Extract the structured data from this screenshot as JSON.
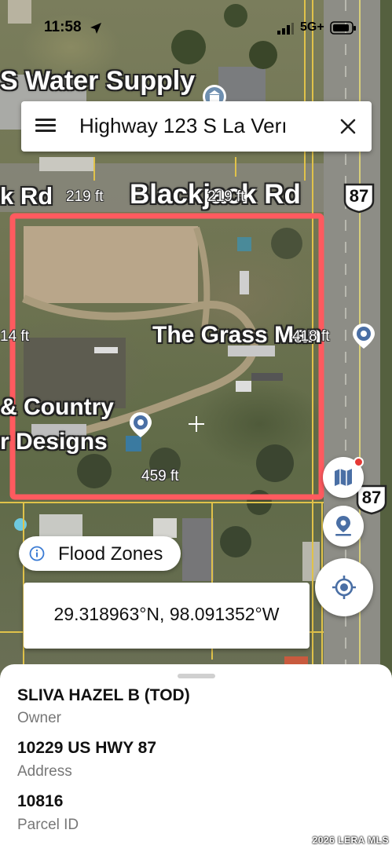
{
  "status_bar": {
    "time": "11:58",
    "network": "5G+",
    "location_icon": "location-arrow-icon",
    "signal_icon": "signal-bars-icon",
    "battery_icon": "battery-icon"
  },
  "search": {
    "query": "Highway 123 S La Verı",
    "menu_icon": "hamburger-menu-icon",
    "close_icon": "close-icon"
  },
  "map": {
    "place_labels": {
      "water_supply": "S Water Supply",
      "blackjack_left": "k Rd",
      "blackjack_main": "Blackjack Rd",
      "grass_man": "The Grass Man",
      "country": "& Country",
      "designs": "r Designs"
    },
    "highway_shields": [
      "87",
      "87"
    ],
    "dimensions": {
      "top_left": "219 ft",
      "top_right": "219 ft",
      "left": "14 ft",
      "right": "418 ft",
      "bottom": "459 ft"
    },
    "parcel_outline_color": "#ff5a5f",
    "pin_icons": [
      "map-pin-icon",
      "map-pin-icon"
    ]
  },
  "controls": {
    "layers_icon": "map-layers-icon",
    "locate_pin_icon": "pin-location-icon",
    "gps_icon": "gps-crosshair-icon",
    "notification_dot_color": "#e53935"
  },
  "flood": {
    "label": "Flood Zones",
    "icon": "info-icon"
  },
  "coordinates": {
    "text": "29.318963°N, 98.091352°W"
  },
  "sheet": {
    "owner_value": "SLIVA HAZEL B (TOD)",
    "owner_label": "Owner",
    "address_value": "10229 US HWY 87",
    "address_label": "Address",
    "parcel_value": "10816",
    "parcel_label": "Parcel ID"
  },
  "watermark": "2026 LERA MLS"
}
